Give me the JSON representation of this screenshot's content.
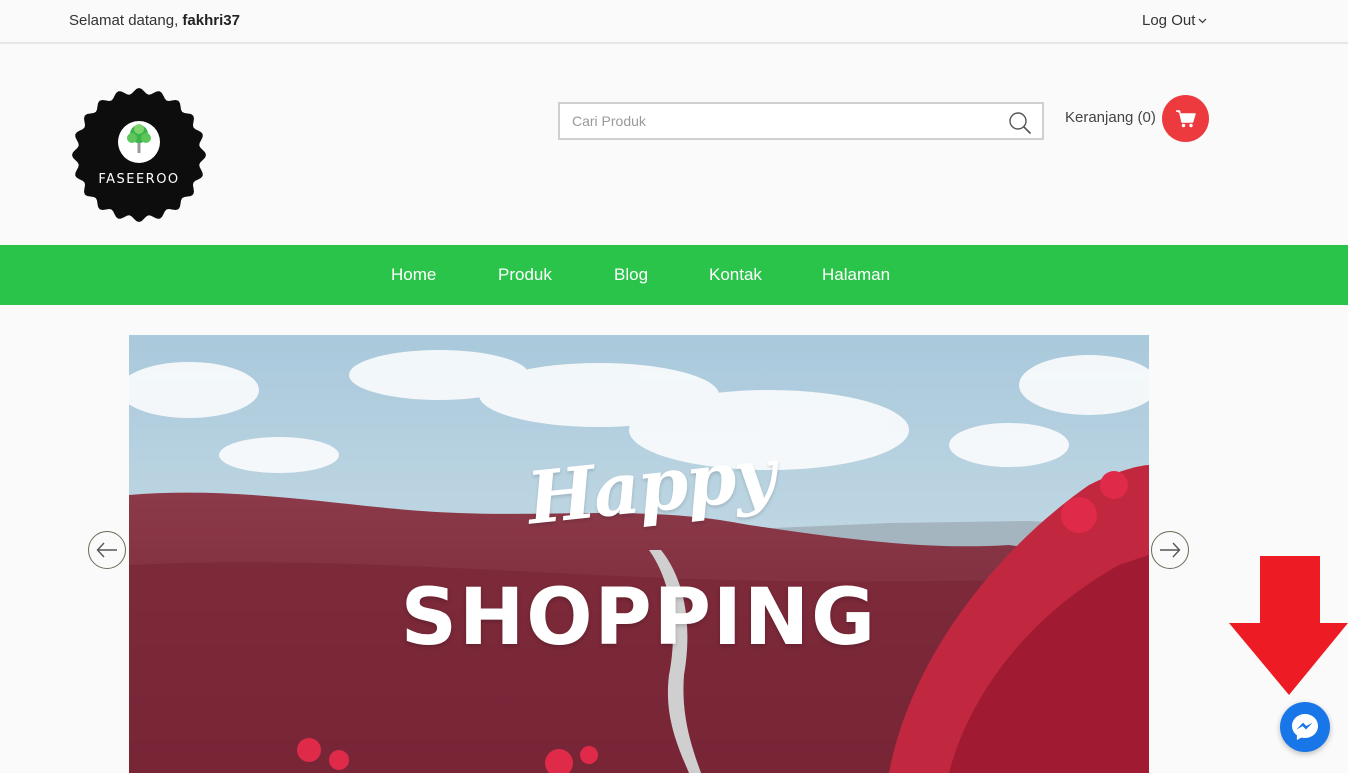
{
  "topbar": {
    "welcome_prefix": "Selamat datang, ",
    "username": "fakhri37",
    "logout_label": "Log Out"
  },
  "logo": {
    "name": "FASEEROO"
  },
  "search": {
    "placeholder": "Cari Produk"
  },
  "cart": {
    "label": "Keranjang (0)"
  },
  "nav": {
    "items": [
      {
        "label": "Home"
      },
      {
        "label": "Produk"
      },
      {
        "label": "Blog"
      },
      {
        "label": "Kontak"
      },
      {
        "label": "Halaman"
      }
    ]
  },
  "slider": {
    "script_text": "Happy",
    "headline": "SHOPPING"
  },
  "colors": {
    "nav_green": "#2bc44a",
    "cart_red": "#ec3a3f",
    "messenger_blue": "#1976e8",
    "annotation_red": "#ed1c24"
  },
  "icons": {
    "search": "search-icon",
    "cart": "cart-icon",
    "prev": "arrow-left-icon",
    "next": "arrow-right-icon",
    "messenger": "messenger-icon",
    "dropdown": "chevron-down-icon"
  }
}
